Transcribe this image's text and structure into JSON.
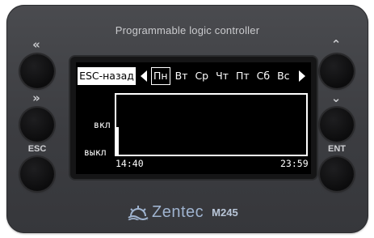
{
  "device": {
    "title": "Programmable logic controller",
    "brand": "Zentec",
    "model": "M245"
  },
  "buttons": {
    "left_top_symbol": "«",
    "left_mid_symbol": "»",
    "esc_label": "ESC",
    "right_top_symbol": "⌃",
    "right_mid_symbol": "⌄",
    "ent_label": "ENT"
  },
  "screen": {
    "esc_back": "ESC-назад",
    "days": [
      "Пн",
      "Вт",
      "Ср",
      "Чт",
      "Пт",
      "Сб",
      "Вс"
    ],
    "selected_day": "Пн",
    "y_on": "вкл",
    "y_off": "выкл",
    "x_start": "14:40",
    "x_end": "23:59"
  },
  "colors": {
    "device_body": "#3e3f43",
    "screen_bg": "#000000",
    "screen_fg": "#ffffff",
    "brand": "#9fb3cf"
  }
}
